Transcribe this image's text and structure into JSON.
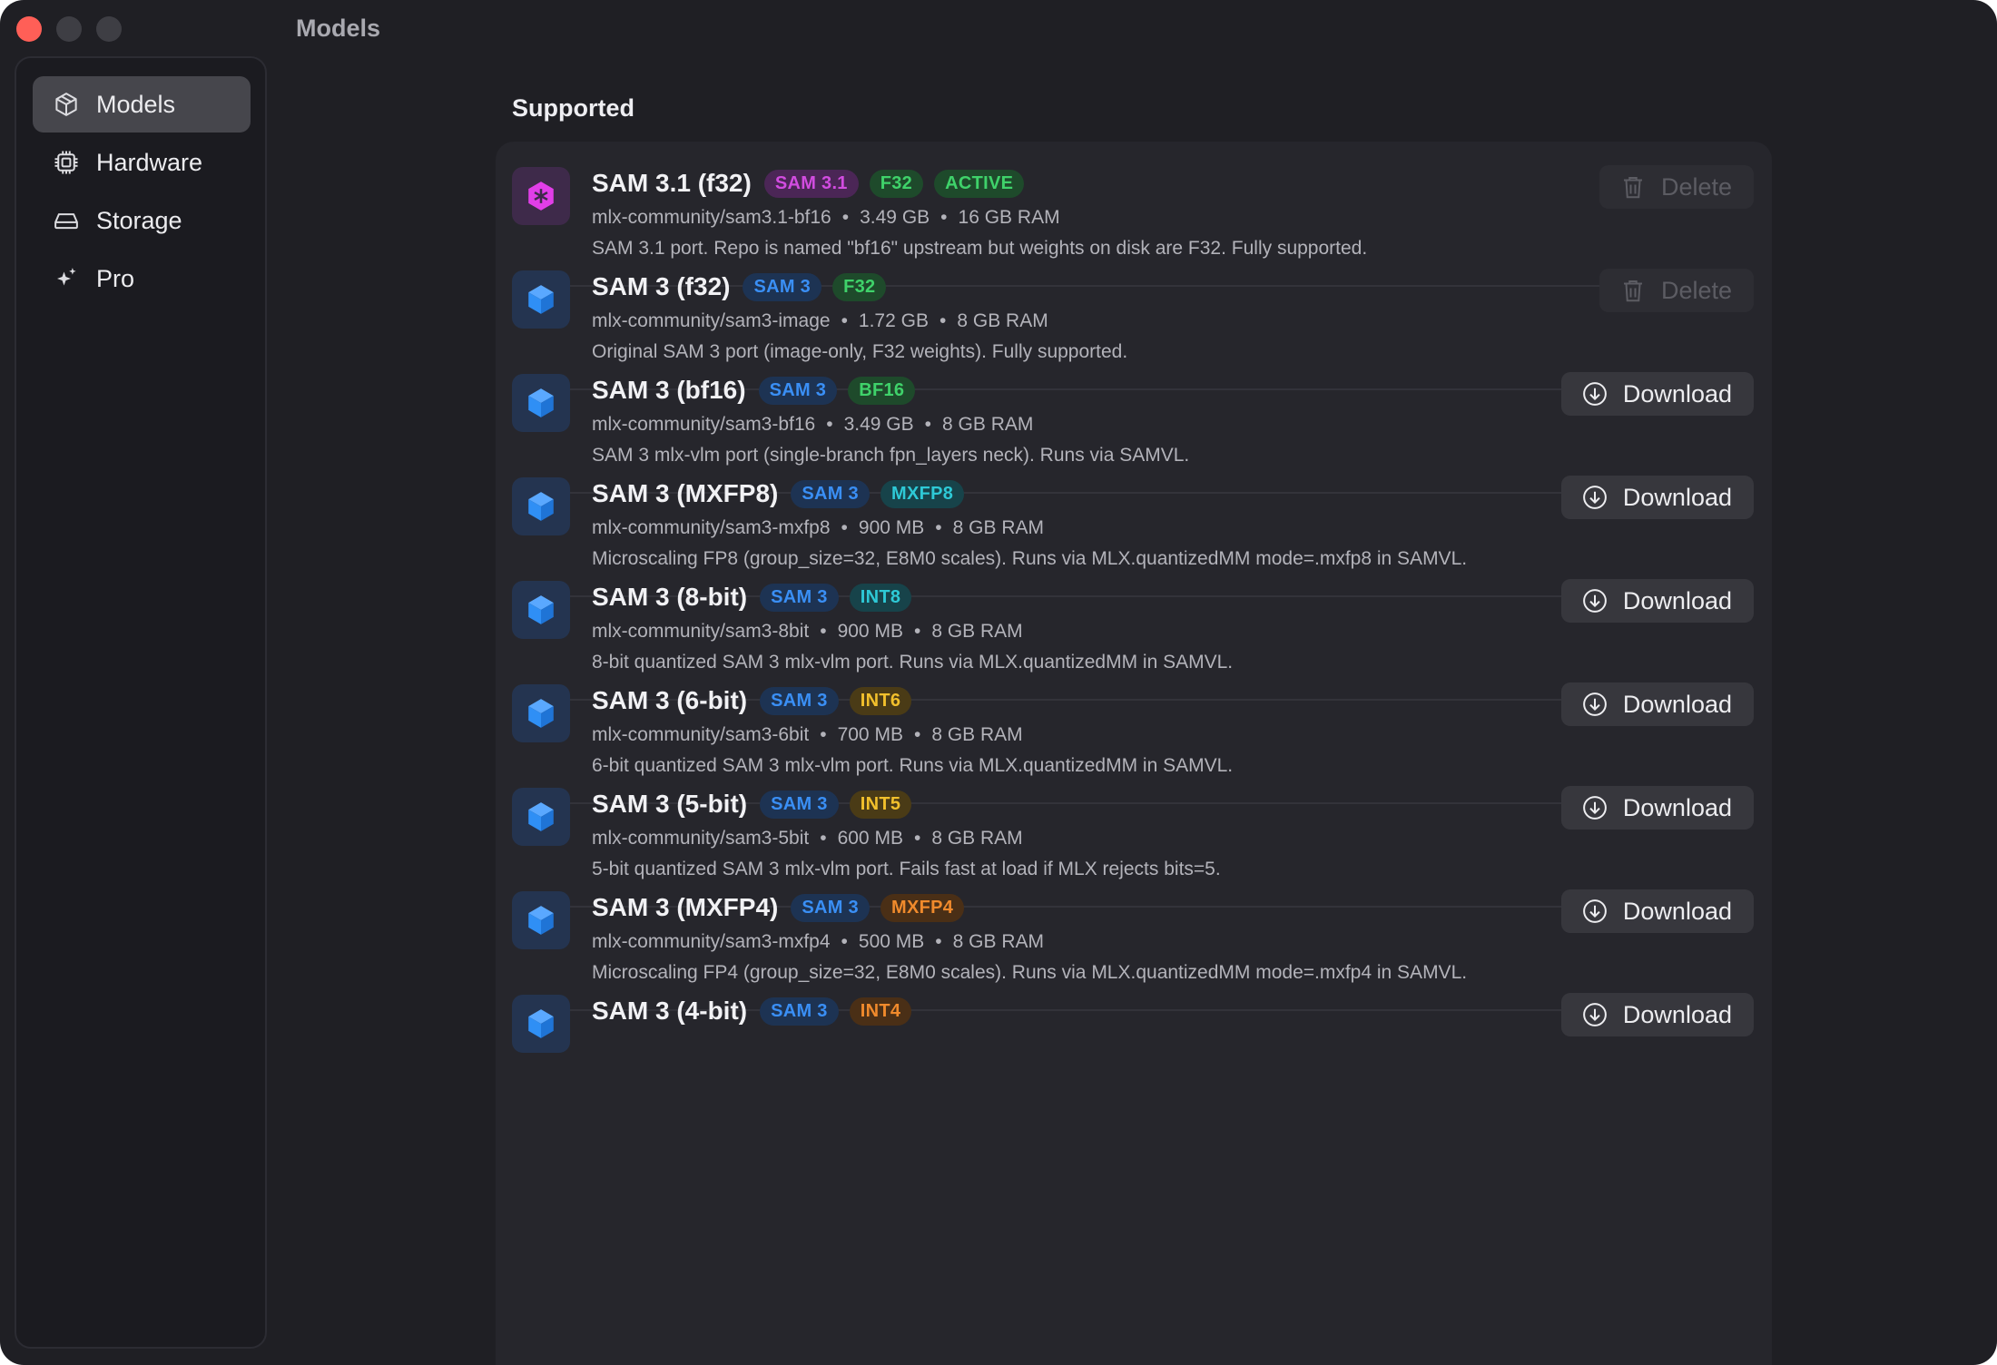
{
  "window": {
    "title": "Models"
  },
  "sidebar": {
    "items": [
      {
        "label": "Models",
        "icon": "cube-icon",
        "active": true
      },
      {
        "label": "Hardware",
        "icon": "chip-icon",
        "active": false
      },
      {
        "label": "Storage",
        "icon": "drive-icon",
        "active": false
      },
      {
        "label": "Pro",
        "icon": "sparkles-icon",
        "active": false
      }
    ]
  },
  "main": {
    "section_title": "Supported",
    "models": [
      {
        "name": "SAM 3.1 (f32)",
        "icon": "hexagon-cube-icon",
        "icon_color": "#e13ee8",
        "badges": [
          {
            "text": "SAM 3.1",
            "color": "#d24ce0",
            "bg": "#4b2656"
          },
          {
            "text": "F32",
            "color": "#3fd26a",
            "bg": "#1e4a2b"
          },
          {
            "text": "ACTIVE",
            "color": "#3fd26a",
            "bg": "#1e4a2b"
          }
        ],
        "repo": "mlx-community/sam3.1-bf16",
        "size": "3.49 GB",
        "ram": "16 GB RAM",
        "description": "SAM 3.1 port. Repo is named \"bf16\" upstream but weights on disk are F32. Fully supported.",
        "action": "Delete"
      },
      {
        "name": "SAM 3 (f32)",
        "icon": "cube-icon",
        "icon_color": "#2f8ff5",
        "badges": [
          {
            "text": "SAM 3",
            "color": "#3a8ff5",
            "bg": "#1d3353"
          },
          {
            "text": "F32",
            "color": "#3fd26a",
            "bg": "#1e4a2b"
          }
        ],
        "repo": "mlx-community/sam3-image",
        "size": "1.72 GB",
        "ram": "8 GB RAM",
        "description": "Original SAM 3 port (image-only, F32 weights). Fully supported.",
        "action": "Delete"
      },
      {
        "name": "SAM 3 (bf16)",
        "icon": "cube-icon",
        "icon_color": "#2f8ff5",
        "badges": [
          {
            "text": "SAM 3",
            "color": "#3a8ff5",
            "bg": "#1d3353"
          },
          {
            "text": "BF16",
            "color": "#3fd26a",
            "bg": "#1e4a2b"
          }
        ],
        "repo": "mlx-community/sam3-bf16",
        "size": "3.49 GB",
        "ram": "8 GB RAM",
        "description": "SAM 3 mlx-vlm port (single-branch fpn_layers neck). Runs via SAMVL.",
        "action": "Download"
      },
      {
        "name": "SAM 3 (MXFP8)",
        "icon": "cube-icon",
        "icon_color": "#2f8ff5",
        "badges": [
          {
            "text": "SAM 3",
            "color": "#3a8ff5",
            "bg": "#1d3353"
          },
          {
            "text": "MXFP8",
            "color": "#2ec9d6",
            "bg": "#17434a"
          }
        ],
        "repo": "mlx-community/sam3-mxfp8",
        "size": "900 MB",
        "ram": "8 GB RAM",
        "description": "Microscaling FP8 (group_size=32, E8M0 scales). Runs via MLX.quantizedMM mode=.mxfp8 in SAMVL.",
        "action": "Download"
      },
      {
        "name": "SAM 3 (8-bit)",
        "icon": "cube-icon",
        "icon_color": "#2f8ff5",
        "badges": [
          {
            "text": "SAM 3",
            "color": "#3a8ff5",
            "bg": "#1d3353"
          },
          {
            "text": "INT8",
            "color": "#2ec9d6",
            "bg": "#17434a"
          }
        ],
        "repo": "mlx-community/sam3-8bit",
        "size": "900 MB",
        "ram": "8 GB RAM",
        "description": "8-bit quantized SAM 3 mlx-vlm port. Runs via MLX.quantizedMM in SAMVL.",
        "action": "Download"
      },
      {
        "name": "SAM 3 (6-bit)",
        "icon": "cube-icon",
        "icon_color": "#2f8ff5",
        "badges": [
          {
            "text": "SAM 3",
            "color": "#3a8ff5",
            "bg": "#1d3353"
          },
          {
            "text": "INT6",
            "color": "#f2c02c",
            "bg": "#4a3b16"
          }
        ],
        "repo": "mlx-community/sam3-6bit",
        "size": "700 MB",
        "ram": "8 GB RAM",
        "description": "6-bit quantized SAM 3 mlx-vlm port. Runs via MLX.quantizedMM in SAMVL.",
        "action": "Download"
      },
      {
        "name": "SAM 3 (5-bit)",
        "icon": "cube-icon",
        "icon_color": "#2f8ff5",
        "badges": [
          {
            "text": "SAM 3",
            "color": "#3a8ff5",
            "bg": "#1d3353"
          },
          {
            "text": "INT5",
            "color": "#f2c02c",
            "bg": "#4a3b16"
          }
        ],
        "repo": "mlx-community/sam3-5bit",
        "size": "600 MB",
        "ram": "8 GB RAM",
        "description": "5-bit quantized SAM 3 mlx-vlm port. Fails fast at load if MLX rejects bits=5.",
        "action": "Download"
      },
      {
        "name": "SAM 3 (MXFP4)",
        "icon": "cube-icon",
        "icon_color": "#2f8ff5",
        "badges": [
          {
            "text": "SAM 3",
            "color": "#3a8ff5",
            "bg": "#1d3353"
          },
          {
            "text": "MXFP4",
            "color": "#f08a2c",
            "bg": "#4a2f16"
          }
        ],
        "repo": "mlx-community/sam3-mxfp4",
        "size": "500 MB",
        "ram": "8 GB RAM",
        "description": "Microscaling FP4 (group_size=32, E8M0 scales). Runs via MLX.quantizedMM mode=.mxfp4 in SAMVL.",
        "action": "Download"
      },
      {
        "name": "SAM 3 (4-bit)",
        "icon": "cube-icon",
        "icon_color": "#2f8ff5",
        "badges": [
          {
            "text": "SAM 3",
            "color": "#3a8ff5",
            "bg": "#1d3353"
          },
          {
            "text": "INT4",
            "color": "#f08a2c",
            "bg": "#4a2f16"
          }
        ],
        "repo": "",
        "size": "",
        "ram": "",
        "description": "",
        "action": "Download"
      }
    ]
  }
}
